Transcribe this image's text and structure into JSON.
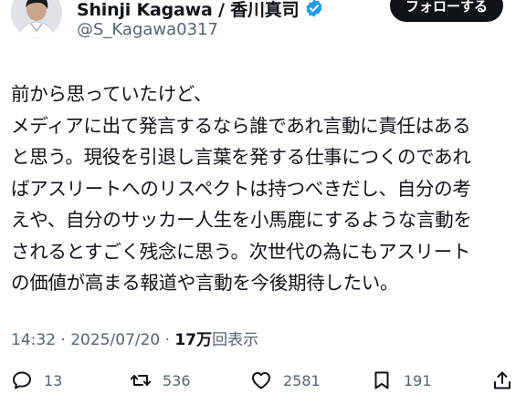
{
  "header": {
    "display_name": "Shinji Kagawa / 香川真司",
    "handle": "@S_Kagawa0317",
    "follow_label": "フォローする",
    "verified_color": "#1d9bf0"
  },
  "tweet": {
    "lines": [
      "前から思っていたけど、",
      "メディアに出て発言するなら誰であれ言動に責任はある",
      "と思う。現役を引退し言葉を発する仕事につくのであれ",
      "ばアスリートへのリスペクトは持つべきだし、自分の考",
      "えや、自分のサッカー人生を小馬鹿にするような言動を",
      "されるとすごく残念に思う。次世代の為にもアスリート",
      "の価値が高まる報道や言動を今後期待したい。"
    ]
  },
  "meta": {
    "time": "14:32",
    "separator": " · ",
    "date": "2025/07/20",
    "views_count": "17万",
    "views_label": "回表示"
  },
  "actions": {
    "reply": {
      "icon": "reply-icon",
      "count": "13"
    },
    "repost": {
      "icon": "repost-icon",
      "count": "536"
    },
    "like": {
      "icon": "heart-icon",
      "count": "2581"
    },
    "bookmark": {
      "icon": "bookmark-icon",
      "count": "191"
    },
    "share": {
      "icon": "share-icon"
    }
  }
}
